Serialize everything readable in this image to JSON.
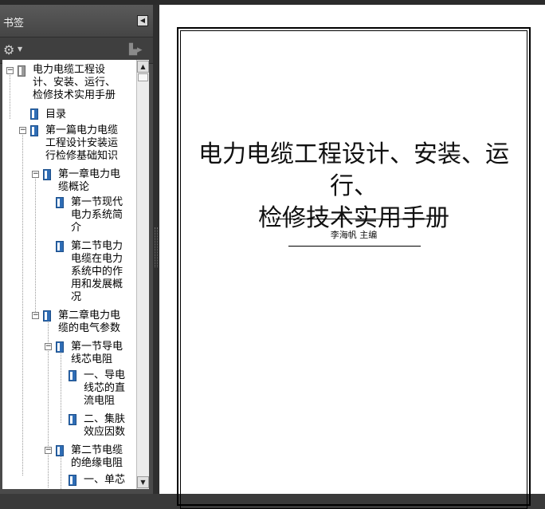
{
  "sidebar": {
    "title": "书签",
    "collapse_icon": "triangle-left-icon",
    "options_icon": "gear-icon",
    "bookmark_tool_icon": "bookmark-icon"
  },
  "bookmarks": [
    {
      "label": "电力电缆工程设计、安装、运行、检修技术实用手册",
      "lines": [
        "电力电缆工程设",
        "计、安装、运行、",
        "检修技术实用手册"
      ],
      "expanded": true
    },
    {
      "label": "目录",
      "lines": [
        "目录"
      ]
    },
    {
      "label": "第一篇电力电缆工程设计安装运行检修基础知识",
      "lines": [
        "第一篇电力电缆",
        "工程设计安装运",
        "行检修基础知识"
      ],
      "expanded": true
    },
    {
      "label": "第一章电力电缆概论",
      "lines": [
        "第一章电力电",
        "缆概论"
      ],
      "expanded": true
    },
    {
      "label": "第一节现代电力系统简介",
      "lines": [
        "第一节现代",
        "电力系统简",
        "介"
      ]
    },
    {
      "label": "第二节电力电缆在电力系统中的作用和发展概况",
      "lines": [
        "第二节电力",
        "电缆在电力",
        "系统中的作",
        "用和发展概",
        "况"
      ]
    },
    {
      "label": "第二章电力电缆的电气参数",
      "lines": [
        "第二章电力电",
        "缆的电气参数"
      ],
      "expanded": true
    },
    {
      "label": "第一节导电线芯电阻",
      "lines": [
        "第一节导电",
        "线芯电阻"
      ],
      "expanded": true
    },
    {
      "label": "一、导电线芯的直流电阻",
      "lines": [
        "一、导电",
        "线芯的直",
        "流电阻"
      ]
    },
    {
      "label": "二、集肤效应因数",
      "lines": [
        "二、集肤",
        "效应因数"
      ]
    },
    {
      "label": "第二节电缆的绝缘电阻",
      "lines": [
        "第二节电缆",
        "的绝缘电阻"
      ],
      "expanded": true
    },
    {
      "label": "一、单芯",
      "lines": [
        "一、单芯"
      ]
    }
  ],
  "document": {
    "title_line1": "电力电缆工程设计、安装、运行、",
    "title_line2": "检修技术实用手册",
    "author": "李海帆   主编"
  }
}
